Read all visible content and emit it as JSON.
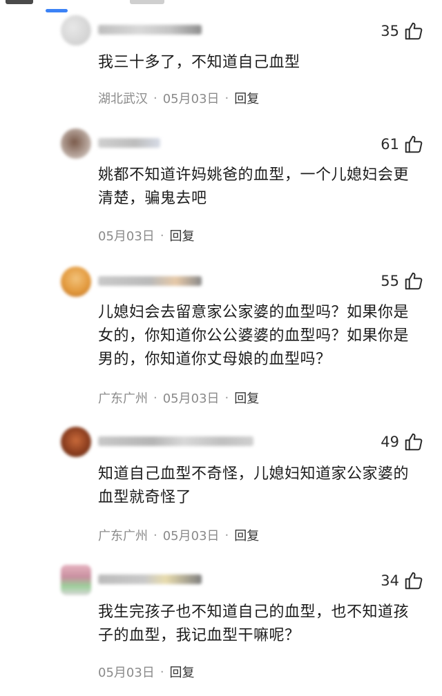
{
  "comments": [
    {
      "text": "我三十多了，不知道自己血型",
      "likes": "35",
      "location": "湖北武汉",
      "date": "05月03日",
      "reply_label": "回复"
    },
    {
      "text": "姚都不知道许妈姚爸的血型，一个儿媳妇会更清楚，骗鬼去吧",
      "likes": "61",
      "location": "",
      "date": "05月03日",
      "reply_label": "回复"
    },
    {
      "text": "儿媳妇会去留意家公家婆的血型吗？如果你是女的，你知道你公公婆婆的血型吗？如果你是男的，你知道你丈母娘的血型吗？",
      "likes": "55",
      "location": "广东广州",
      "date": "05月03日",
      "reply_label": "回复"
    },
    {
      "text": "知道自己血型不奇怪，儿媳妇知道家公家婆的血型就奇怪了",
      "likes": "49",
      "location": "广东广州",
      "date": "05月03日",
      "reply_label": "回复"
    },
    {
      "text": "我生完孩子也不知道自己的血型，也不知道孩子的血型，我记血型干嘛呢？",
      "likes": "34",
      "location": "",
      "date": "05月03日",
      "reply_label": "回复"
    }
  ],
  "separator_dot": "·",
  "icons": {
    "like": "thumbs-up-icon"
  },
  "colors": {
    "accent_indicator": "#3b82f6",
    "meta_text": "#8a8a8a"
  }
}
